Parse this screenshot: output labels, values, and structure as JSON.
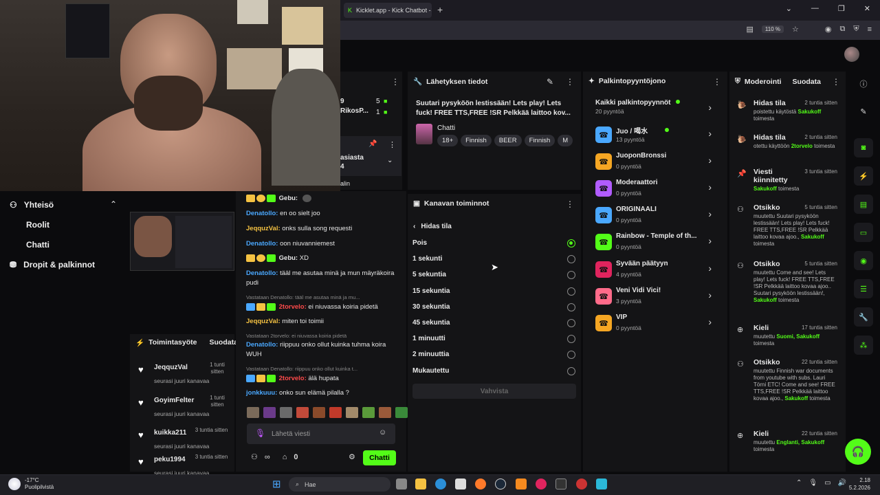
{
  "browser": {
    "tab_title": "Kicklet.app - Kick Chatbot -",
    "zoom": "110 %",
    "tab_icon": "kick-k-icon"
  },
  "left_nav": {
    "section": "Yhteisö",
    "items": [
      "Roolit",
      "Chatti",
      "Dropit & palkinnot"
    ]
  },
  "activity": {
    "title": "Toimintasyöte",
    "filter": "Suodata",
    "rows": [
      {
        "name": "JeqquzVal",
        "time": "1 tunti sitten",
        "desc": "seurasi juuri kanavaa"
      },
      {
        "name": "GoyimFelter",
        "time": "1 tunti sitten",
        "desc": "seurasi juuri kanavaa"
      },
      {
        "name": "kuikka211",
        "time": "3 tuntia sitten",
        "desc": "seurasi juuri kanavaa"
      },
      {
        "name": "peku1994",
        "time": "3 tuntia sitten",
        "desc": "seurasi juuri kanavaa"
      }
    ]
  },
  "chat": {
    "lines": [
      {
        "user": "Gebu:",
        "text": "",
        "color": "#e6e6e6"
      },
      {
        "user": "Denatollo:",
        "text": "en oo sielt joo",
        "color": "#4aa8ff"
      },
      {
        "user": "JeqquzVal:",
        "text": "onks sulla song requesti",
        "color": "#f5c242"
      },
      {
        "user": "Denatollo:",
        "text": "oon niuvanniemest",
        "color": "#4aa8ff"
      },
      {
        "user": "Gebu:",
        "text": "XD",
        "color": "#e6e6e6"
      },
      {
        "user": "Denatollo:",
        "text": "tääl me asutaa minä ja mun mäyräkoira pudi",
        "color": "#4aa8ff"
      },
      {
        "user": "2torvelo:",
        "text": "ei niuvassa koiria pidetä",
        "color": "#ff4a4a"
      },
      {
        "user": "JeqquzVal:",
        "text": "miten toi toimii",
        "color": "#f5c242"
      },
      {
        "user": "Denatollo:",
        "text": "riippuu onko ollut kuinka tuhma koira WUH",
        "color": "#4aa8ff"
      },
      {
        "user": "2torvelo:",
        "text": "älä hupata",
        "color": "#ff4a4a"
      },
      {
        "user": "jonkkuuu:",
        "text": "onko sun elämä pilalla ?",
        "color": "#4aa8ff"
      }
    ],
    "replies": [
      "Vastataan Denatollo: tääl me asutaa minä ja mu...",
      "Vastataan 2torvelo: ei niuvassa koiria pidetä",
      "Vastataan Denatollo: riippuu onko ollut kuinka t..."
    ],
    "placeholder": "Lähetä viesti",
    "points": "0",
    "send_label": "Chatti",
    "pinned_partial": "asiasta",
    "pinned_partial2": "4",
    "partial_text": "alin",
    "partial_user": "RikosP...",
    "partial_nums": [
      "5",
      "1"
    ],
    "partial_9": "9"
  },
  "stream_info": {
    "title": "Lähetyksen tiedot",
    "stream_title": "Suutari pysyköön lestissään! Lets play! Lets fuck! FREE TTS,FREE !SR Pelkkää laittoo kov...",
    "category": "Chatti",
    "tags": [
      "18+",
      "Finnish",
      "BEER",
      "Finnish",
      "M"
    ]
  },
  "channel_actions": {
    "title": "Kanavan toiminnot",
    "back_label": "Hidas tila",
    "options": [
      "Pois",
      "1 sekunti",
      "5 sekuntia",
      "15 sekuntia",
      "30 sekuntia",
      "45 sekuntia",
      "1 minuutti",
      "2 minuuttia",
      "Mukautettu"
    ],
    "selected": 0,
    "confirm": "Vahvista"
  },
  "rewards": {
    "title": "Palkintopyyntöjono",
    "all_label": "Kaikki palkintopyynnöt",
    "all_count": "20 pyyntöä",
    "items": [
      {
        "name": "Juo / 喝水",
        "count": "13 pyyntöä",
        "color": "#4aa8ff",
        "dot": true
      },
      {
        "name": "JuoponBronssi",
        "count": "0 pyyntöä",
        "color": "#f5a623",
        "dot": false
      },
      {
        "name": "Moderaattori",
        "count": "0 pyyntöä",
        "color": "#b15cff",
        "dot": false
      },
      {
        "name": "ORIGINAALI",
        "count": "0 pyyntöä",
        "color": "#4aa8ff",
        "dot": false
      },
      {
        "name": "Rainbow - Temple of th...",
        "count": "0 pyyntöä",
        "color": "#53fc18",
        "dot": false
      },
      {
        "name": "Syvään päätyyn",
        "count": "4 pyyntöä",
        "color": "#e0245e",
        "dot": false
      },
      {
        "name": "Veni Vidi Vici!",
        "count": "3 pyyntöä",
        "color": "#ff6b8a",
        "dot": false
      },
      {
        "name": "VIP",
        "count": "0 pyyntöä",
        "color": "#f5a623",
        "dot": false
      }
    ]
  },
  "moderation": {
    "title": "Moderointi",
    "filter": "Suodata",
    "items": [
      {
        "icon": "snail-icon",
        "title": "Hidas tila",
        "time": "2 tuntia sitten",
        "pre": "poistettu käytöstä",
        "who": "Sakukoff",
        "post": "toimesta"
      },
      {
        "icon": "snail-icon",
        "title": "Hidas tila",
        "time": "2 tuntia sitten",
        "pre": "otettu käyttöön",
        "who": "2torvelo",
        "post": "toimesta"
      },
      {
        "icon": "pin-icon",
        "title": "Viesti kiinnitetty",
        "time": "3 tuntia sitten",
        "pre": "",
        "who": "Sakukoff",
        "post": "toimesta"
      },
      {
        "icon": "people-icon",
        "title": "Otsikko",
        "time": "5 tuntia sitten",
        "pre": "muutettu Suutari pysyköön lestissään! Lets play! Lets fuck! FREE TTS,FREE !SR Pelkkää laittoo kovaa ajoo.,",
        "who": "Sakukoff",
        "post": "toimesta"
      },
      {
        "icon": "people-icon",
        "title": "Otsikko",
        "time": "5 tuntia sitten",
        "pre": "muutettu Come and see! Lets play! Lets fuck! FREE TTS,FREE !SR Pelkkää laittoo kovaa ajoo.. Suutari pysyköön lestissään!,",
        "who": "Sakukoff",
        "post": "toimesta"
      },
      {
        "icon": "globe-icon",
        "title": "Kieli",
        "time": "17 tuntia sitten",
        "pre": "muutettu",
        "who": "Suomi, Sakukoff",
        "post": "toimesta"
      },
      {
        "icon": "people-icon",
        "title": "Otsikko",
        "time": "22 tuntia sitten",
        "pre": "muutettu Finnish war documents from youtube with subs. Lauri Törni ETC! Come and see! FREE TTS,FREE !SR Pelkkää laittoo kovaa ajoo.,",
        "who": "Sakukoff",
        "post": "toimesta"
      },
      {
        "icon": "globe-icon",
        "title": "Kieli",
        "time": "22 tuntia sitten",
        "pre": "muutettu",
        "who": "Englanti, Sakukoff",
        "post": "toimesta"
      }
    ]
  },
  "taskbar": {
    "temp": "-17°C",
    "weather": "Puolipilvistä",
    "search": "Hae",
    "time": "2.18",
    "date": "5.2.2026"
  }
}
